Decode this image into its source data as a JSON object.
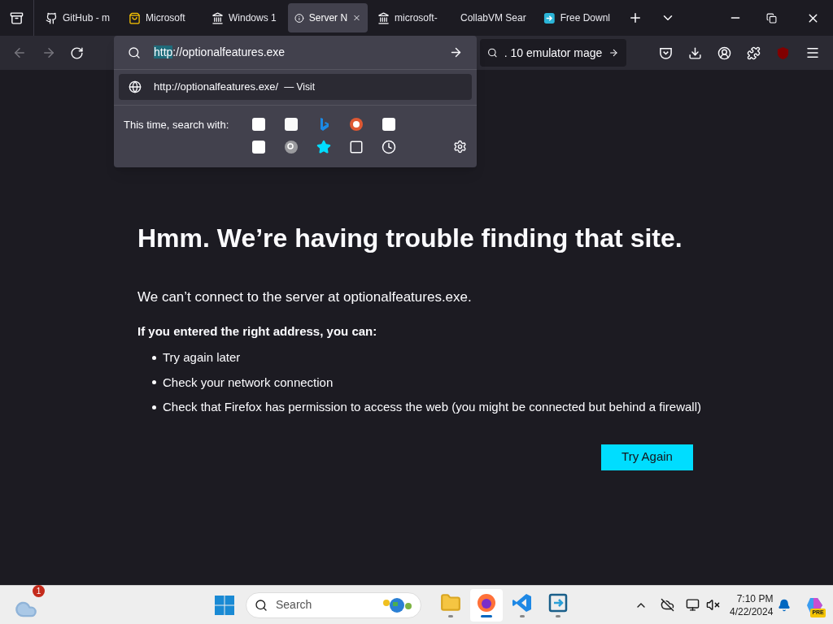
{
  "tabs": [
    {
      "title": "GitHub - m",
      "kind": "github",
      "selected": false
    },
    {
      "title": "Microsoft",
      "kind": "store",
      "selected": false
    },
    {
      "title": "Windows 1",
      "kind": "archive",
      "selected": false
    },
    {
      "title": "Server N",
      "kind": "error",
      "selected": true
    },
    {
      "title": "microsoft-",
      "kind": "archive",
      "selected": false
    },
    {
      "title": "CollabVM Sear",
      "kind": "plain",
      "selected": false
    },
    {
      "title": "Free Downl",
      "kind": "app",
      "selected": false
    }
  ],
  "address_bar": {
    "selected_text": "http",
    "rest_text": "://optionalfeatures.exe"
  },
  "suggestion": {
    "url": "http://optionalfeatures.exe/",
    "action": "— Visit"
  },
  "search_with": {
    "label": "This time, search with:"
  },
  "search_bar": {
    "value": ". 10 emulator mage"
  },
  "error_page": {
    "title": "Hmm. We’re having trouble finding that site.",
    "message": "We can’t connect to the server at optionalfeatures.exe.",
    "subtitle": "If you entered the right address, you can:",
    "tips": [
      "Try again later",
      "Check your network connection",
      "Check that Firefox has permission to access the web (you might be connected but behind a firewall)"
    ],
    "button": "Try Again"
  },
  "taskbar": {
    "weather_badge": "1",
    "search_placeholder": "Search",
    "apps": [
      {
        "kind": "folder",
        "selected": false
      },
      {
        "kind": "firefox",
        "selected": true
      },
      {
        "kind": "vscode",
        "selected": false
      },
      {
        "kind": "remote",
        "selected": false
      }
    ],
    "time": "7:10 PM",
    "date": "4/22/2024",
    "copilot_badge": "PRE"
  }
}
